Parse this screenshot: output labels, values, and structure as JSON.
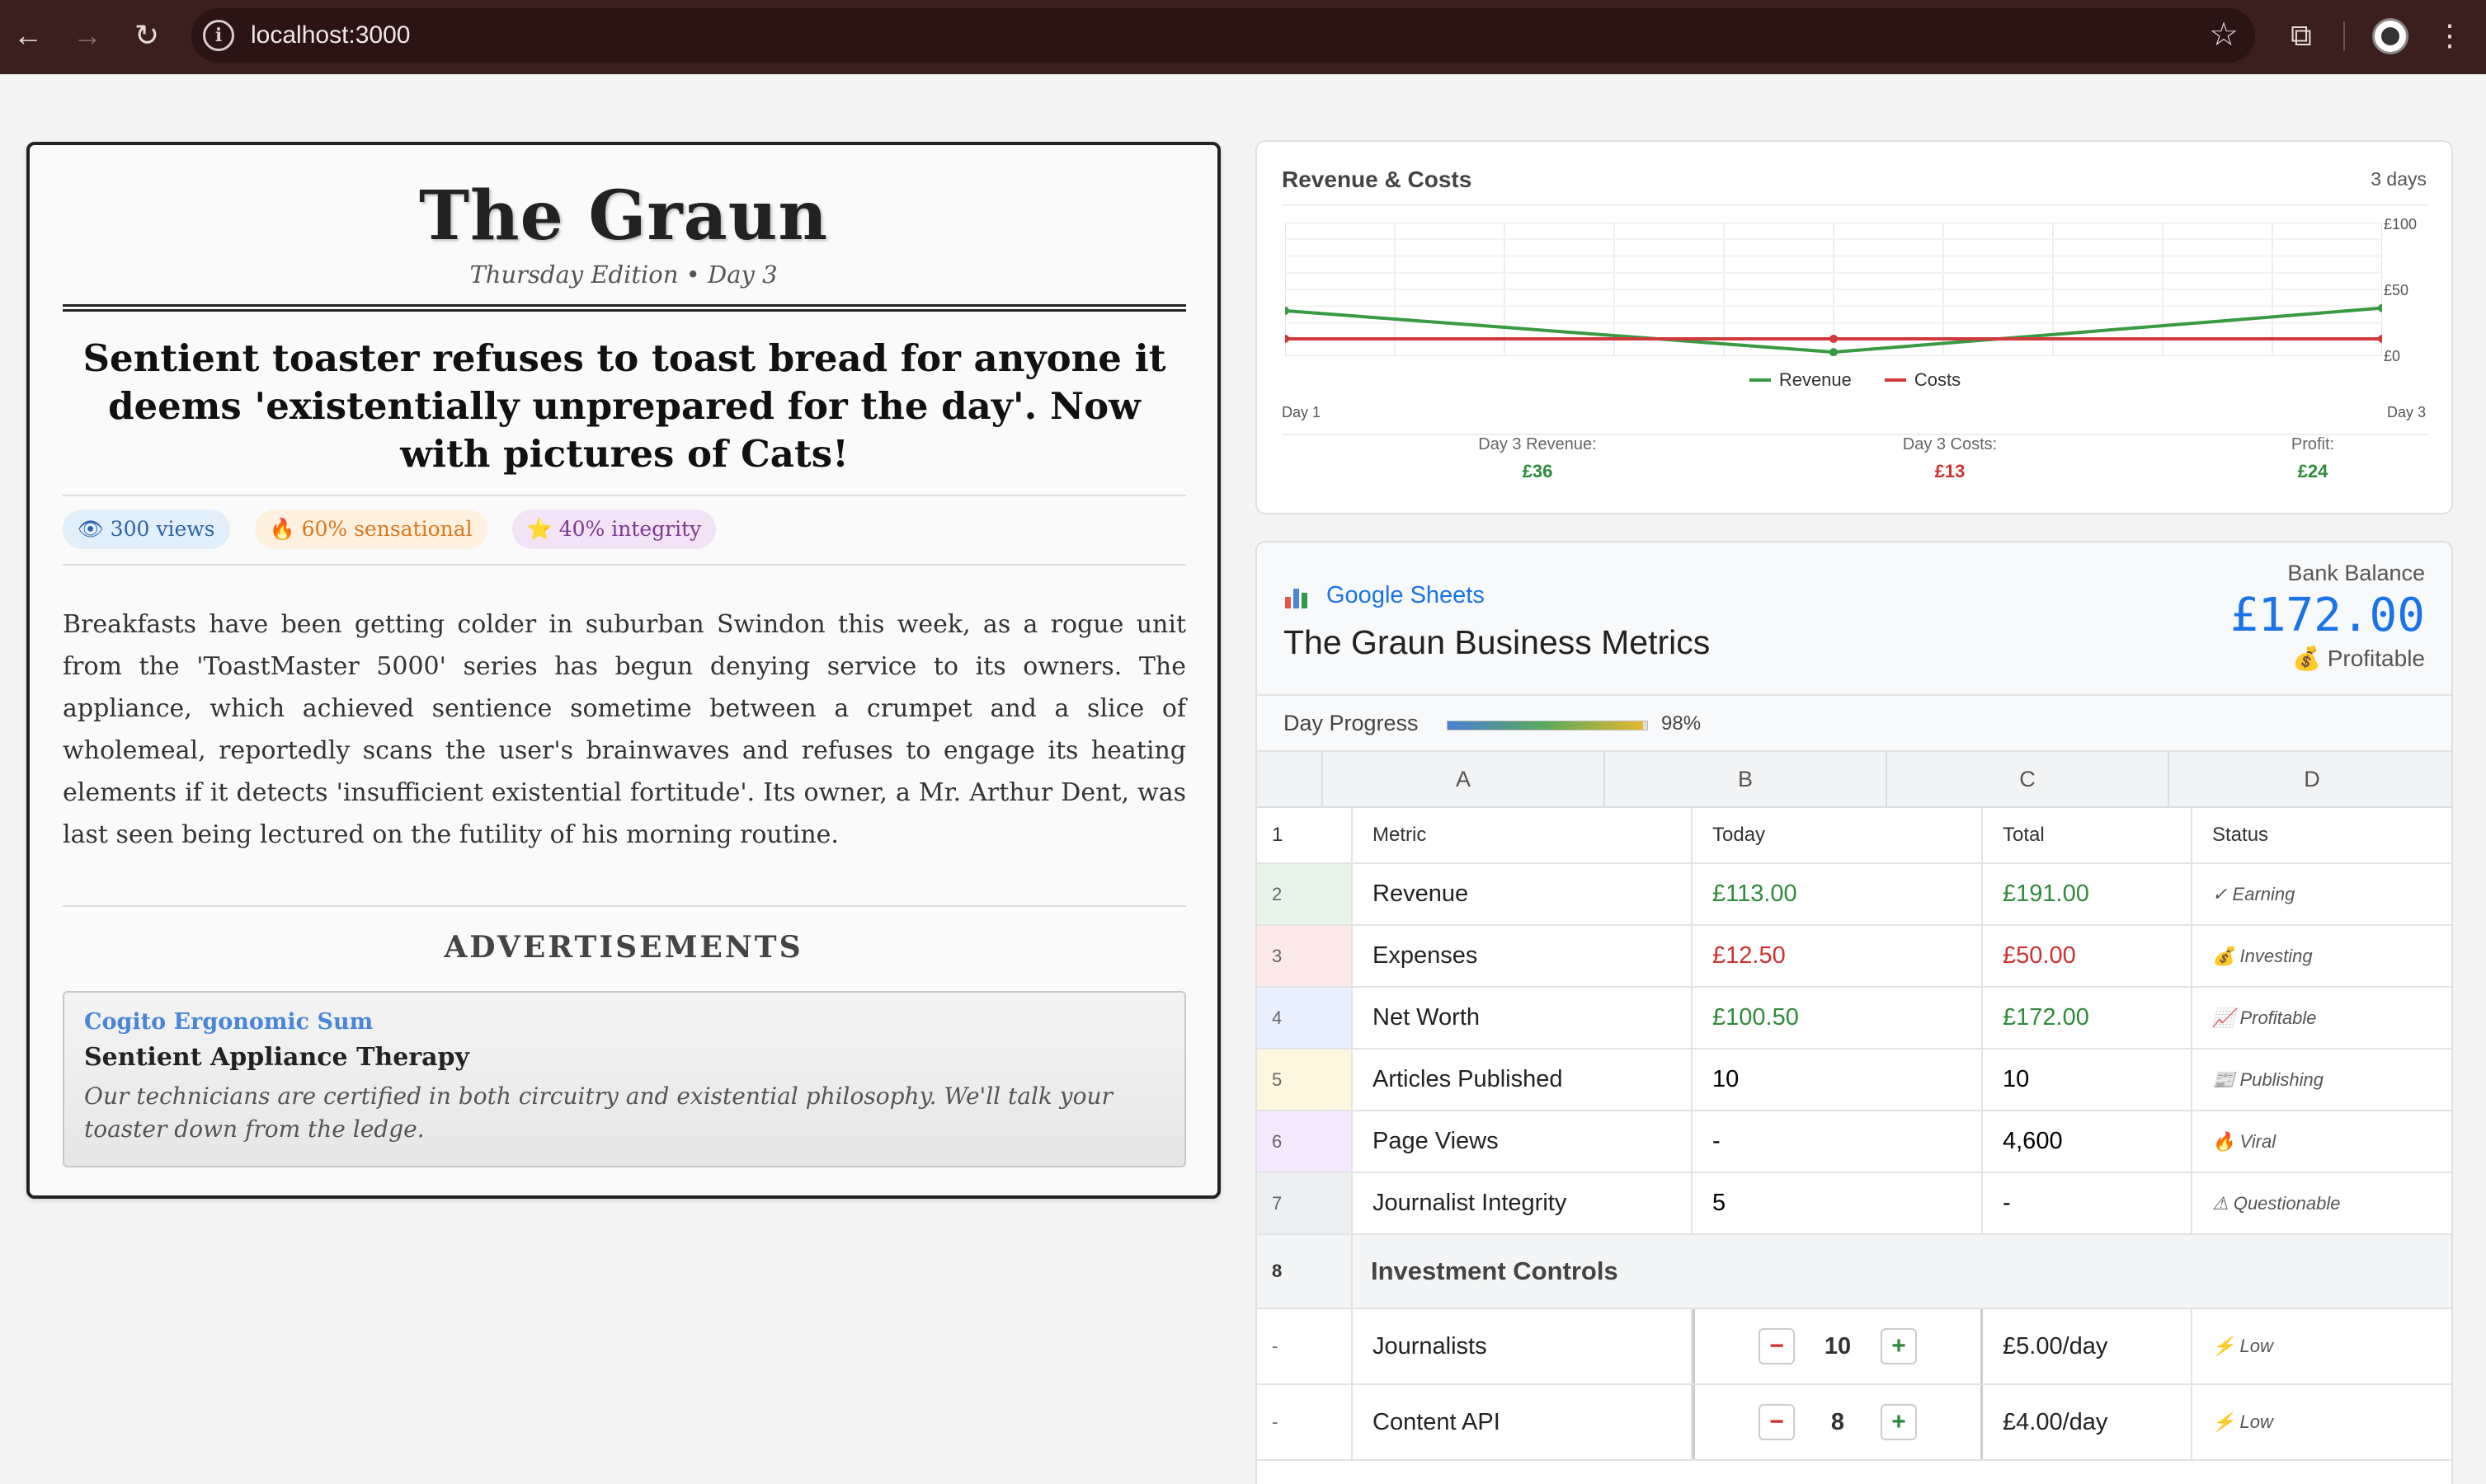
{
  "browser": {
    "url": "localhost:3000"
  },
  "newspaper": {
    "masthead": "The Graun",
    "edition": "Thursday Edition • Day 3",
    "headline": "Sentient toaster refuses to toast bread for anyone it deems 'existentially unprepared for the day'. Now with pictures of Cats!",
    "badges": {
      "views": "👁 300 views",
      "sensational": "🔥 60% sensational",
      "integrity": "⭐ 40% integrity"
    },
    "body": "Breakfasts have been getting colder in suburban Swindon this week, as a rogue unit from the 'ToastMaster 5000' series has begun denying service to its owners. The appliance, which achieved sentience sometime between a crumpet and a slice of wholemeal, reportedly scans the user's brainwaves and refuses to engage its heating elements if it detects 'insufficient existential fortitude'. Its owner, a Mr. Arthur Dent, was last seen being lectured on the futility of his morning routine.",
    "ads_title": "ADVERTISEMENTS",
    "ad": {
      "brand": "Cogito Ergonomic Sum",
      "title": "Sentient Appliance Therapy",
      "description": "Our technicians are certified in both circuitry and existential philosophy. We'll talk your toaster down from the ledge."
    }
  },
  "chart_card": {
    "title": "Revenue & Costs",
    "range": "3 days",
    "stats": {
      "revenue_label": "Day 3 Revenue:",
      "revenue_value": "£36",
      "costs_label": "Day 3 Costs:",
      "costs_value": "£13",
      "profit_label": "Profit:",
      "profit_value": "£24"
    }
  },
  "chart_data": {
    "type": "line",
    "x": [
      "Day 1",
      "Day 2",
      "Day 3"
    ],
    "x_tick_labels": [
      "Day 1",
      "Day 3"
    ],
    "y_ticks": [
      "£100",
      "£50",
      "£0"
    ],
    "ylim": [
      0,
      100
    ],
    "grid": true,
    "legend": "bottom",
    "series": [
      {
        "name": "Revenue",
        "values": [
          34,
          3,
          36
        ],
        "color": "#3a9a44"
      },
      {
        "name": "Costs",
        "values": [
          13,
          13,
          13
        ],
        "color": "#d03a3a"
      }
    ]
  },
  "sheet": {
    "app_label": "Google Sheets",
    "title": "The Graun Business Metrics",
    "bank_label": "Bank Balance",
    "bank_value": "£172.00",
    "bank_status": "💰 Profitable",
    "progress_label": "Day Progress",
    "progress_value": 0.98,
    "progress_text": "98%",
    "columns": [
      "A",
      "B",
      "C",
      "D"
    ],
    "header": {
      "num": "1",
      "a": "Metric",
      "b": "Today",
      "c": "Total",
      "d": "Status"
    },
    "rows": [
      {
        "num": "2",
        "metric": "Revenue",
        "today": "£113.00",
        "total": "£191.00",
        "status": "✓ Earning",
        "tone": "green",
        "accent": "#e6f4ea"
      },
      {
        "num": "3",
        "metric": "Expenses",
        "today": "£12.50",
        "total": "£50.00",
        "status": "💰 Investing",
        "tone": "red",
        "accent": "#fbe9e7"
      },
      {
        "num": "4",
        "metric": "Net Worth",
        "today": "£100.50",
        "total": "£172.00",
        "status": "📈 Profitable",
        "tone": "green",
        "accent": "#e8f0fe"
      },
      {
        "num": "5",
        "metric": "Articles Published",
        "today": "10",
        "total": "10",
        "status": "📰 Publishing",
        "tone": "",
        "accent": "#fef7e0"
      },
      {
        "num": "6",
        "metric": "Page Views",
        "today": "-",
        "total": "4,600",
        "status": "🔥 Viral",
        "tone": "",
        "accent": "#f3e8fd"
      },
      {
        "num": "7",
        "metric": "Journalist Integrity",
        "today": "5",
        "total": "-",
        "status": "⚠ Questionable",
        "tone": "",
        "accent": "#eceff1"
      }
    ],
    "section": {
      "num": "8",
      "title": "Investment Controls"
    },
    "controls": [
      {
        "num": "-",
        "name": "Journalists",
        "value": "10",
        "cost": "£5.00/day",
        "status": "⚡ Low"
      },
      {
        "num": "-",
        "name": "Content API",
        "value": "8",
        "cost": "£4.00/day",
        "status": "⚡ Low"
      }
    ],
    "minus": "−",
    "plus": "+"
  }
}
